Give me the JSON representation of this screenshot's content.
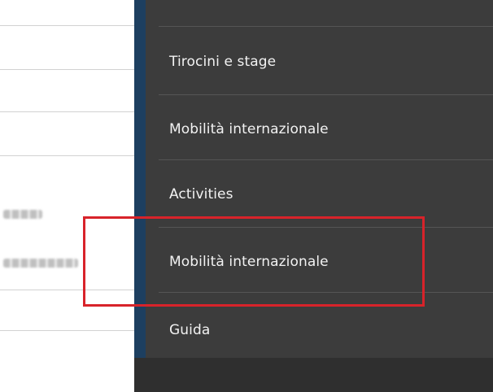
{
  "menu": {
    "items": [
      {
        "label": "Tirocini e stage"
      },
      {
        "label": "Mobilità internazionale"
      },
      {
        "label": "Activities"
      },
      {
        "label": "Mobilità internazionale"
      },
      {
        "label": "Guida"
      }
    ]
  },
  "colors": {
    "accent": "#1d3f60",
    "panel_bg": "#3c3c3c",
    "highlight": "#d8232a"
  }
}
